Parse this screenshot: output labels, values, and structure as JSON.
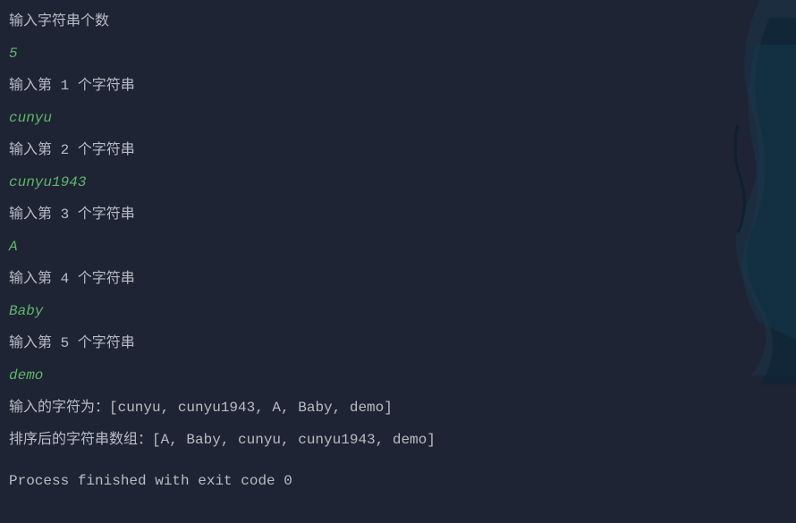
{
  "console": {
    "lines": [
      {
        "type": "prompt",
        "text": "输入字符串个数"
      },
      {
        "type": "input",
        "text": "5"
      },
      {
        "type": "prompt",
        "text": "输入第 1 个字符串"
      },
      {
        "type": "input",
        "text": "cunyu"
      },
      {
        "type": "prompt",
        "text": "输入第 2 个字符串"
      },
      {
        "type": "input",
        "text": "cunyu1943"
      },
      {
        "type": "prompt",
        "text": "输入第 3 个字符串"
      },
      {
        "type": "input",
        "text": "A"
      },
      {
        "type": "prompt",
        "text": "输入第 4 个字符串"
      },
      {
        "type": "input",
        "text": "Baby"
      },
      {
        "type": "prompt",
        "text": "输入第 5 个字符串"
      },
      {
        "type": "input",
        "text": "demo"
      }
    ],
    "output_original": "输入的字符为：[cunyu, cunyu1943, A, Baby, demo]",
    "output_sorted": "排序后的字符串数组：[A, Baby, cunyu, cunyu1943, demo]",
    "exit_message": "Process finished with exit code 0"
  }
}
